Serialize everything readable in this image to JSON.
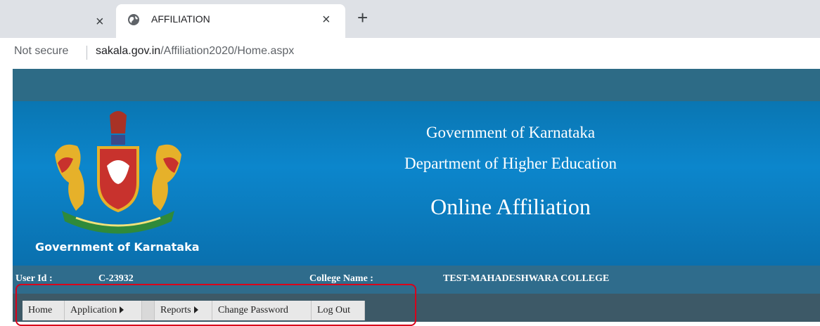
{
  "browser": {
    "tabs": [
      {
        "title": "",
        "close": "×"
      },
      {
        "title": "AFFILIATION",
        "close": "×"
      }
    ],
    "new_tab": "+",
    "security": "Not secure",
    "url_host": "sakala.gov.in",
    "url_path": "/Affiliation2020/Home.aspx"
  },
  "header": {
    "emblem_caption": "Government of Karnataka",
    "line1": "Government of Karnataka",
    "line2": "Department of Higher Education",
    "line3": "Online Affiliation"
  },
  "info": {
    "user_id_label": "User Id :",
    "user_id_value": "C-23932",
    "college_label": "College Name :",
    "college_value": "TEST-MAHADESHWARA COLLEGE"
  },
  "menu": {
    "home": "Home",
    "application": "Application",
    "blank": "",
    "reports": "Reports",
    "change_password": "Change Password",
    "logout": "Log Out"
  }
}
